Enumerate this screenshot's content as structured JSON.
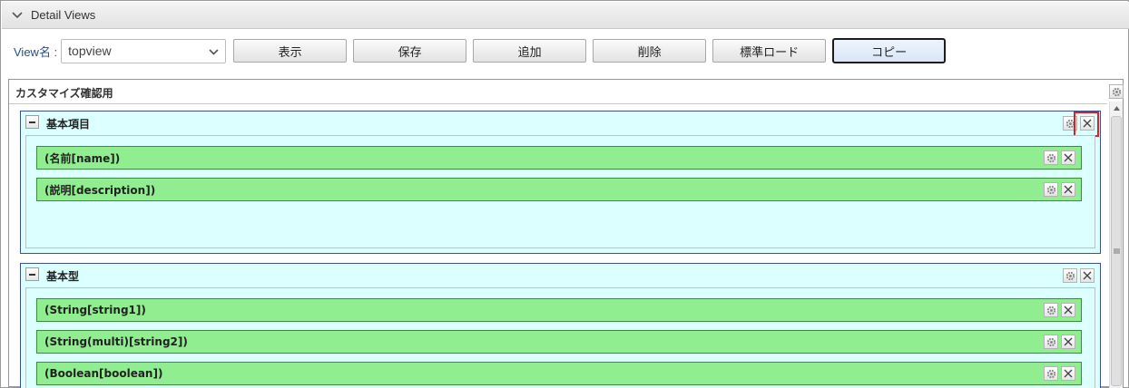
{
  "panel": {
    "title": "Detail Views",
    "icon": "chevron-down-icon"
  },
  "toolbar": {
    "view_label": "View名 :",
    "view_select_value": "topview",
    "buttons": [
      "表示",
      "保存",
      "追加",
      "削除",
      "標準ロード",
      "コピー"
    ],
    "active_button": "コピー"
  },
  "layout_area": {
    "title": "カスタマイズ確認用"
  },
  "sections": [
    {
      "title": "基本項目",
      "close_highlighted": true,
      "fields": [
        "(名前[name])",
        "(説明[description])"
      ]
    },
    {
      "title": "基本型",
      "close_highlighted": false,
      "fields": [
        "(String[string1])",
        "(String(multi)[string2])",
        "(Boolean[boolean])"
      ]
    }
  ],
  "colors": {
    "section_bg": "#dcffff",
    "section_border": "#3b4f9a",
    "field_bg": "#90ee90",
    "field_border": "#3d8b3d",
    "highlight": "#e01e1e",
    "label_blue": "#2a4f86"
  }
}
